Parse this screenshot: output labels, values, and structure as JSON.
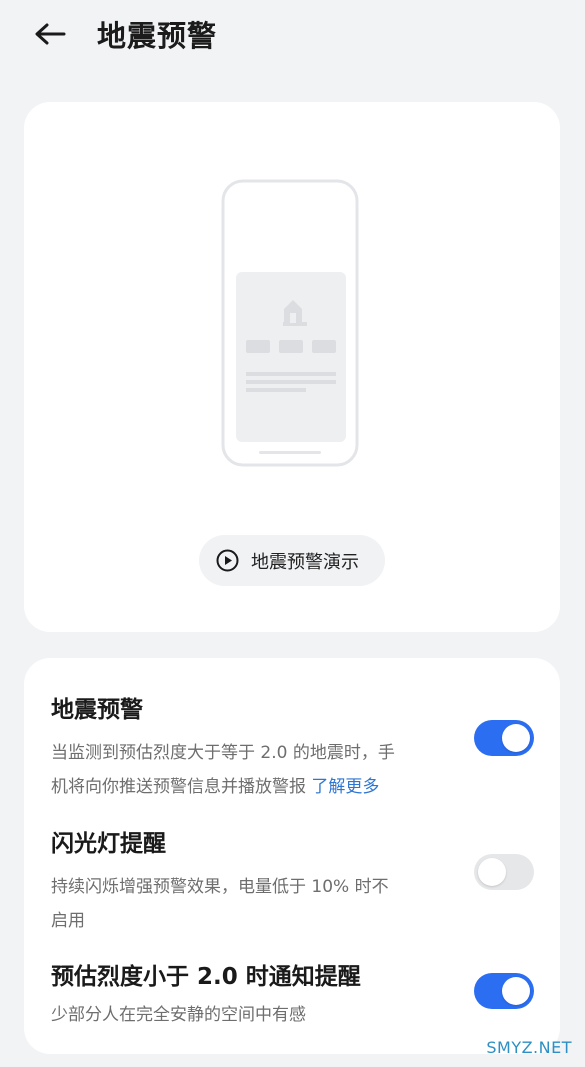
{
  "header": {
    "back_icon": "arrow-left-icon",
    "title": "地震预警"
  },
  "demo": {
    "illustration": "phone-alert-illustration",
    "button_icon": "play-circle-icon",
    "button_label": "地震预警演示"
  },
  "settings": [
    {
      "title": "地震预警",
      "desc_line1": "当监测到预估烈度大于等于 2.0 的地震时，手",
      "desc_line2": "机将向你推送预警信息并播放警报 ",
      "link": "了解更多",
      "enabled": true
    },
    {
      "title": "闪光灯提醒",
      "desc_line1": "持续闪烁增强预警效果，电量低于 10% 时不",
      "desc_line2": "启用",
      "enabled": false
    },
    {
      "title": "预估烈度小于 2.0 时通知提醒",
      "desc_line1": "少部分人在完全安静的空间中有感",
      "enabled": true
    }
  ],
  "colors": {
    "accent": "#2b6ef2",
    "link": "#2f76d2",
    "background": "#f1f3f5"
  },
  "watermark": "SMYZ.NET"
}
